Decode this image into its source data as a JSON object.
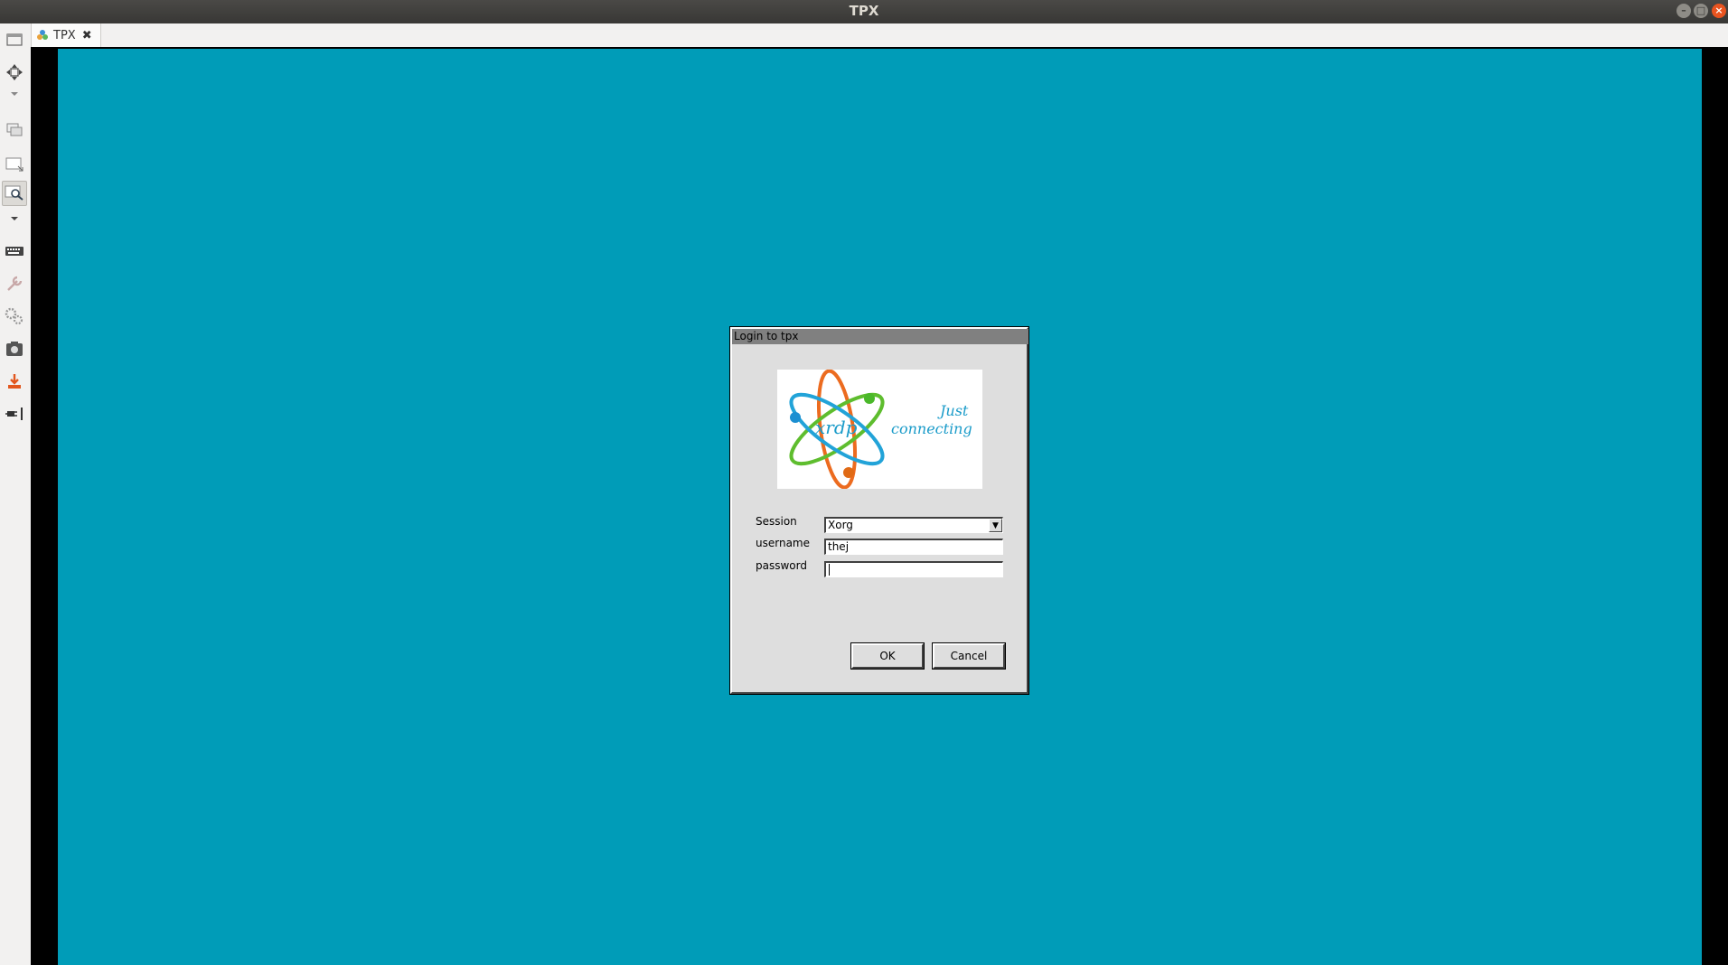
{
  "window": {
    "title": "TPX",
    "controls": {
      "minimize": "–",
      "maximize": "□",
      "close": "×"
    }
  },
  "tabs": [
    {
      "label": "TPX",
      "icon": "remmina-connection-icon",
      "close_glyph": "✖"
    }
  ],
  "toolbar": {
    "items": [
      "toggle-fullscreen-icon",
      "toggle-dynamic-resolution-icon",
      "dropdown-arrow-icon",
      "switch-tab-icon",
      "scaled-mode-icon",
      "zoom-icon",
      "dropdown-arrow-icon",
      "keyboard-grab-icon",
      "preferences-icon",
      "tools-icon",
      "screenshot-icon",
      "minimize-window-icon",
      "disconnect-icon"
    ]
  },
  "dialog": {
    "title": "Login to tpx",
    "logo": {
      "brand": "xrdp",
      "tagline1": "Just",
      "tagline2": "connecting"
    },
    "session_label": "Session",
    "session_value": "Xorg",
    "username_label": "username",
    "username_value": "thej",
    "password_label": "password",
    "password_value": "",
    "ok_label": "OK",
    "cancel_label": "Cancel"
  },
  "colors": {
    "desktop_bg": "#009cb8",
    "dialog_bg": "#dedede",
    "titlebar_bg": "#3c3b37",
    "close_accent": "#e95420"
  }
}
